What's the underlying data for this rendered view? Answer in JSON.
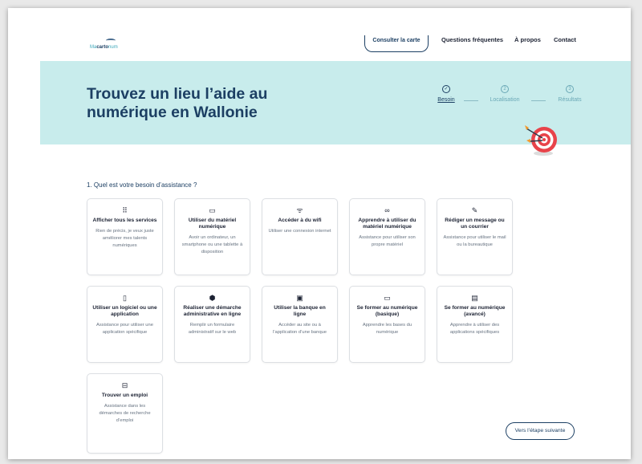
{
  "nav": {
    "logo_text_a": "Ma",
    "logo_text_b": "carto",
    "logo_text_c": "num",
    "map_button": "Consulter la carte",
    "links": [
      "Questions fréquentes",
      "À propos",
      "Contact"
    ]
  },
  "hero": {
    "title": "Trouvez un lieu l’aide au numérique en Wallonie",
    "steps": [
      {
        "icon": "✓",
        "label": "Besoin"
      },
      {
        "icon": "2",
        "label": "Localisation"
      },
      {
        "icon": "3",
        "label": "Résultats"
      }
    ]
  },
  "question": "1. Quel est votre besoin d’assistance ?",
  "cards": [
    {
      "icon": "grid-dots-icon",
      "glyph": "⠿",
      "title": "Afficher tous les services",
      "desc": "Rien de précis, je veux juste améliorer mes talents numériques"
    },
    {
      "icon": "devices-icon",
      "glyph": "▭",
      "title": "Utiliser du matériel numérique",
      "desc": "Avoir un ordinateur, un smartphone ou une tablette à disposition"
    },
    {
      "icon": "wifi-icon",
      "glyph": "ᯤ",
      "title": "Accéder à du wifi",
      "desc": "Utiliser une connexion internet"
    },
    {
      "icon": "link-icon",
      "glyph": "∞",
      "title": "Apprendre à utiliser du matériel numérique",
      "desc": "Assistance pour utiliser son propre matériel"
    },
    {
      "icon": "pencil-icon",
      "glyph": "✎",
      "title": "Rédiger un message ou un courrier",
      "desc": "Assistance pour utiliser le mail ou la bureautique"
    },
    {
      "icon": "phone-icon",
      "glyph": "▯",
      "title": "Utiliser un logiciel ou une application",
      "desc": "Assistance pour utiliser une application spécifique"
    },
    {
      "icon": "shield-icon",
      "glyph": "⬢",
      "title": "Réaliser une démarche administrative en ligne",
      "desc": "Remplir un formulaire administratif sur le web"
    },
    {
      "icon": "bank-icon",
      "glyph": "▣",
      "title": "Utiliser la banque en ligne",
      "desc": "Accéder au site ou à l’application d’une banque"
    },
    {
      "icon": "laptop-icon",
      "glyph": "▭",
      "title": "Se former au numérique (basique)",
      "desc": "Apprendre les bases du numérique"
    },
    {
      "icon": "book-icon",
      "glyph": "▤",
      "title": "Se former au numérique (avancé)",
      "desc": "Apprendre à utiliser des applications spécifiques"
    },
    {
      "icon": "briefcase-icon",
      "glyph": "⊟",
      "title": "Trouver un emploi",
      "desc": "Assistance dans les démarches de recherche d’emploi"
    }
  ],
  "next_button": "Vers l’étape suivante",
  "colors": {
    "primary": "#1c3f63",
    "hero_bg": "#c8ecec",
    "accent": "#3aa6b9",
    "target_red": "#e8434a"
  }
}
